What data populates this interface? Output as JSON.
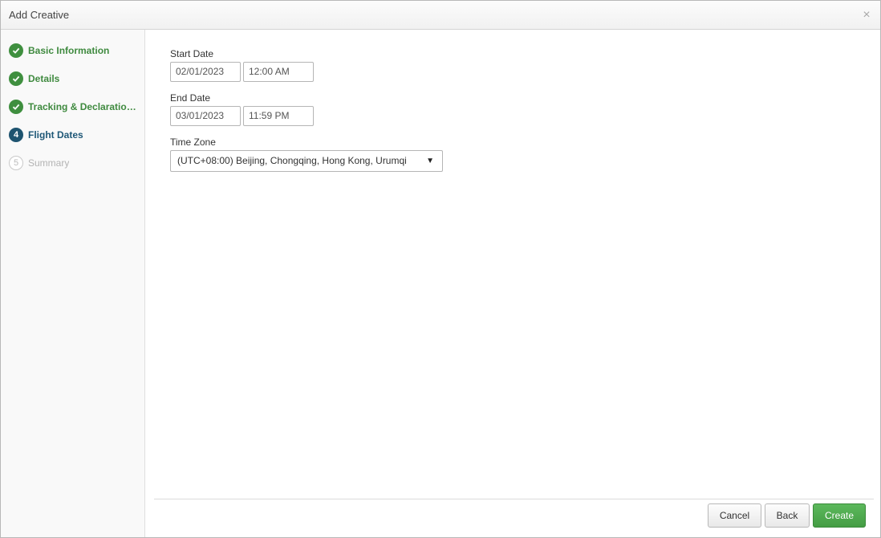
{
  "dialog": {
    "title": "Add Creative",
    "close_glyph": "×"
  },
  "steps": [
    {
      "number": "1",
      "label": "Basic Information",
      "state": "done"
    },
    {
      "number": "2",
      "label": "Details",
      "state": "done"
    },
    {
      "number": "3",
      "label": "Tracking & Declaratio…",
      "state": "done"
    },
    {
      "number": "4",
      "label": "Flight Dates",
      "state": "active"
    },
    {
      "number": "5",
      "label": "Summary",
      "state": "pending"
    }
  ],
  "form": {
    "start_date_label": "Start Date",
    "start_date_value": "02/01/2023",
    "start_time_value": "12:00 AM",
    "end_date_label": "End Date",
    "end_date_value": "03/01/2023",
    "end_time_value": "11:59 PM",
    "timezone_label": "Time Zone",
    "timezone_value": "(UTC+08:00) Beijing, Chongqing, Hong Kong, Urumqi"
  },
  "buttons": {
    "cancel": "Cancel",
    "back": "Back",
    "create": "Create"
  },
  "colors": {
    "done": "#3f8f3f",
    "active": "#1e5470",
    "primary_button": "#4cae4c"
  }
}
